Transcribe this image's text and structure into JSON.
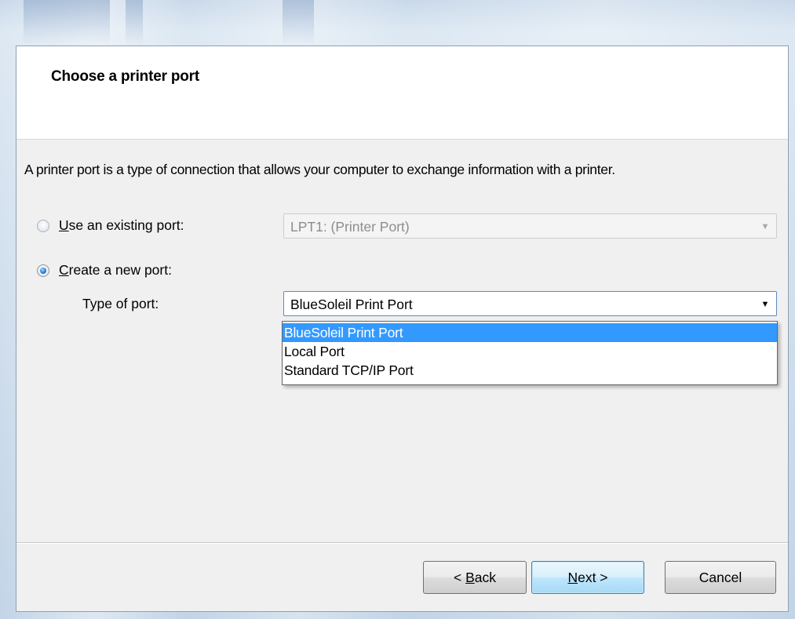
{
  "dialog": {
    "title": "Choose a printer port",
    "description": "A printer port is a type of connection that allows your computer to exchange information with a printer."
  },
  "existing_port": {
    "label_mnemonic": "U",
    "label_rest": "se an existing port:",
    "selected": false,
    "combo_value": "LPT1: (Printer Port)",
    "enabled": false
  },
  "new_port": {
    "label_mnemonic": "C",
    "label_rest": "reate a new port:",
    "selected": true,
    "type_label": "Type of port:",
    "combo_value": "BlueSoleil Print Port",
    "options": [
      "BlueSoleil Print Port",
      "Local Port",
      "Standard TCP/IP Port"
    ],
    "highlighted_option": "BlueSoleil Print Port"
  },
  "buttons": {
    "back_prefix": "< ",
    "back_mnemonic": "B",
    "back_rest": "ack",
    "next_mnemonic": "N",
    "next_rest": "ext >",
    "cancel": "Cancel"
  },
  "colors": {
    "highlight": "#3399ff",
    "client_background": "#f0f0f0",
    "header_background": "#ffffff",
    "default_button_border": "#3c7fb1"
  },
  "icons": {
    "dropdown_arrow": "▼"
  }
}
